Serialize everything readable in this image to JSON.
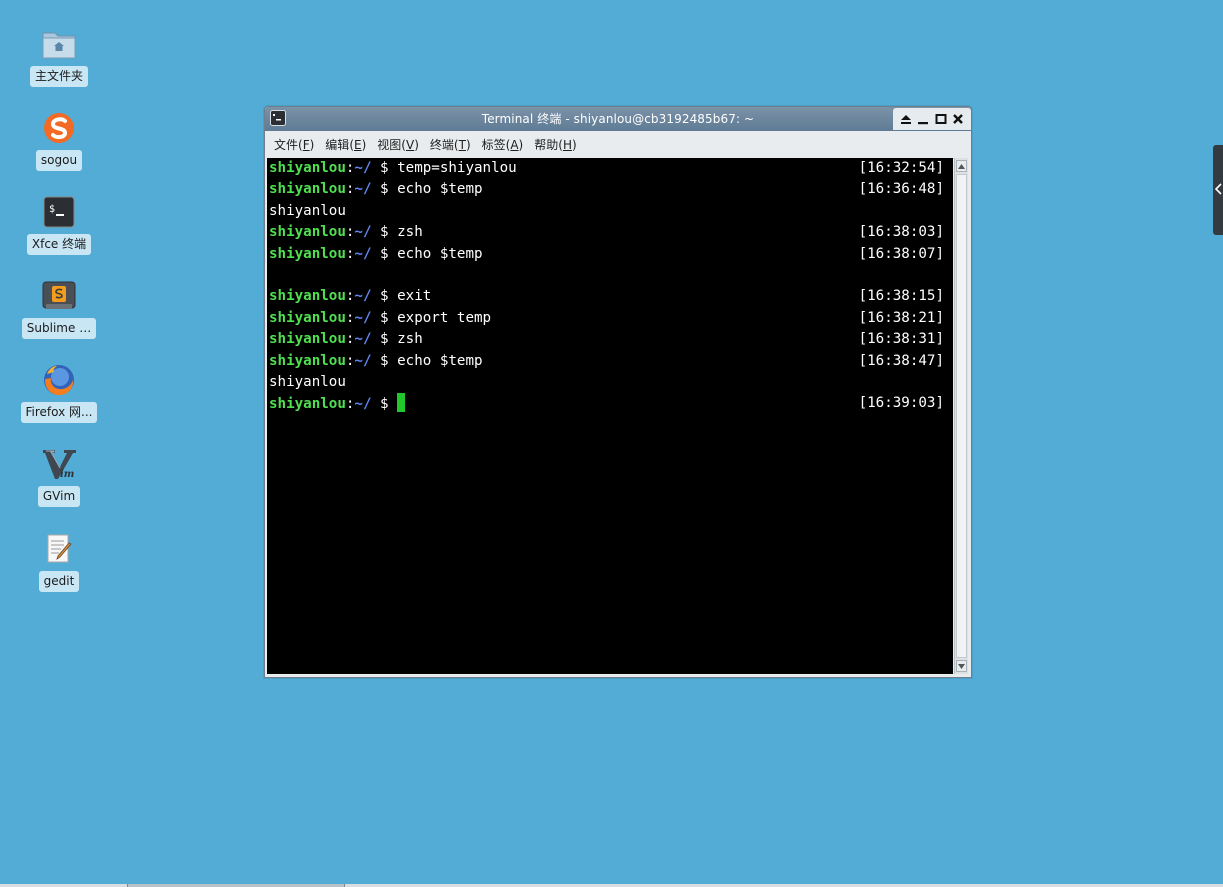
{
  "desktop": {
    "icons": [
      {
        "label": "主文件夹",
        "icon": "home-folder-icon"
      },
      {
        "label": "sogou",
        "icon": "sogou-icon"
      },
      {
        "label": "Xfce 终端",
        "icon": "terminal-icon"
      },
      {
        "label": "Sublime …",
        "icon": "sublime-icon"
      },
      {
        "label": "Firefox 网...",
        "icon": "firefox-icon"
      },
      {
        "label": "GVim",
        "icon": "gvim-icon"
      },
      {
        "label": "gedit",
        "icon": "gedit-icon"
      }
    ]
  },
  "window": {
    "title": "Terminal 终端 - shiyanlou@cb3192485b67: ~",
    "menu": [
      {
        "label": "文件",
        "key": "F"
      },
      {
        "label": "编辑",
        "key": "E"
      },
      {
        "label": "视图",
        "key": "V"
      },
      {
        "label": "终端",
        "key": "T"
      },
      {
        "label": "标签",
        "key": "A"
      },
      {
        "label": "帮助",
        "key": "H"
      }
    ]
  },
  "terminal": {
    "lines": [
      {
        "type": "prompt",
        "user": "shiyanlou",
        "colon": ":",
        "path": "~/",
        "dollar": " $ ",
        "cmd": "temp=shiyanlou",
        "time": "[16:32:54]"
      },
      {
        "type": "prompt",
        "user": "shiyanlou",
        "colon": ":",
        "path": "~/",
        "dollar": " $ ",
        "cmd": "echo $temp",
        "time": "[16:36:48]"
      },
      {
        "type": "output",
        "text": "shiyanlou"
      },
      {
        "type": "prompt",
        "user": "shiyanlou",
        "colon": ":",
        "path": "~/",
        "dollar": " $ ",
        "cmd": "zsh",
        "time": "[16:38:03]"
      },
      {
        "type": "prompt",
        "user": "shiyanlou",
        "colon": ":",
        "path": "~/",
        "dollar": " $ ",
        "cmd": "echo $temp",
        "time": "[16:38:07]"
      },
      {
        "type": "output",
        "text": ""
      },
      {
        "type": "prompt",
        "user": "shiyanlou",
        "colon": ":",
        "path": "~/",
        "dollar": " $ ",
        "cmd": "exit",
        "time": "[16:38:15]"
      },
      {
        "type": "prompt",
        "user": "shiyanlou",
        "colon": ":",
        "path": "~/",
        "dollar": " $ ",
        "cmd": "export temp",
        "time": "[16:38:21]"
      },
      {
        "type": "prompt",
        "user": "shiyanlou",
        "colon": ":",
        "path": "~/",
        "dollar": " $ ",
        "cmd": "zsh",
        "time": "[16:38:31]"
      },
      {
        "type": "prompt",
        "user": "shiyanlou",
        "colon": ":",
        "path": "~/",
        "dollar": " $ ",
        "cmd": "echo $temp",
        "time": "[16:38:47]"
      },
      {
        "type": "output",
        "text": "shiyanlou"
      },
      {
        "type": "prompt",
        "user": "shiyanlou",
        "colon": ":",
        "path": "~/",
        "dollar": " $ ",
        "cmd": "",
        "time": "[16:39:03]",
        "cursor": true
      }
    ]
  },
  "colors": {
    "desktop_bg": "#52acd6",
    "prompt_user": "#4fe04f",
    "prompt_path": "#5e86f2",
    "cursor": "#22c72b"
  }
}
